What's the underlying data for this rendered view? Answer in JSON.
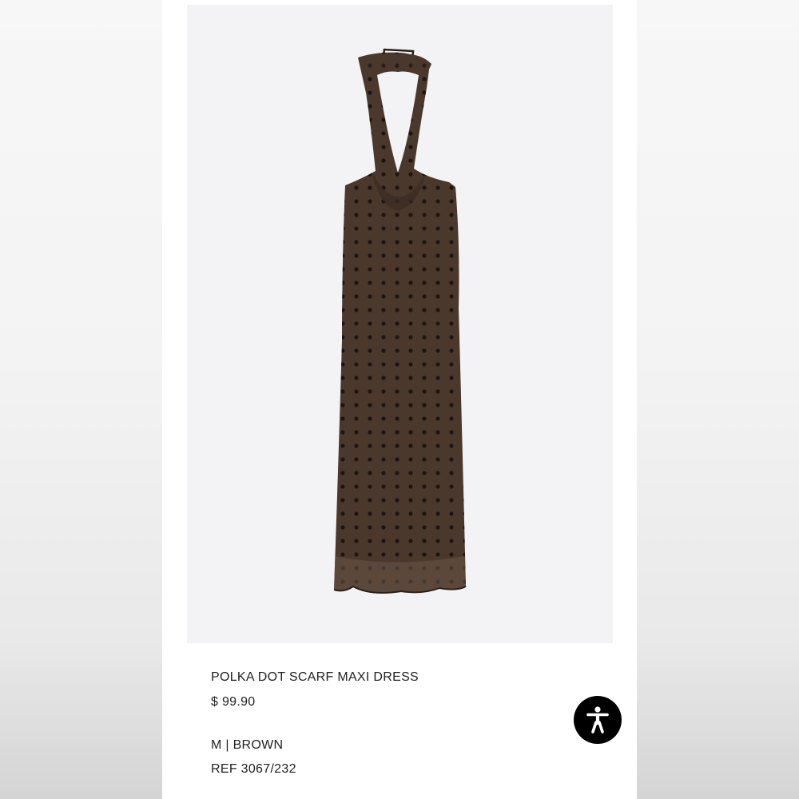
{
  "product": {
    "name": "POLKA DOT SCARF MAXI DRESS",
    "price": "$ 99.90",
    "variant": "M | BROWN",
    "reference": "REF 3067/232"
  },
  "image": {
    "subject": "brown polka dot halter maxi dress",
    "fabric_color": "#4a382c",
    "dot_color": "#1e1410",
    "background_color": "#f3f3f5"
  },
  "accessibility_button": {
    "icon": "accessibility-person-icon",
    "color": "#000000"
  }
}
